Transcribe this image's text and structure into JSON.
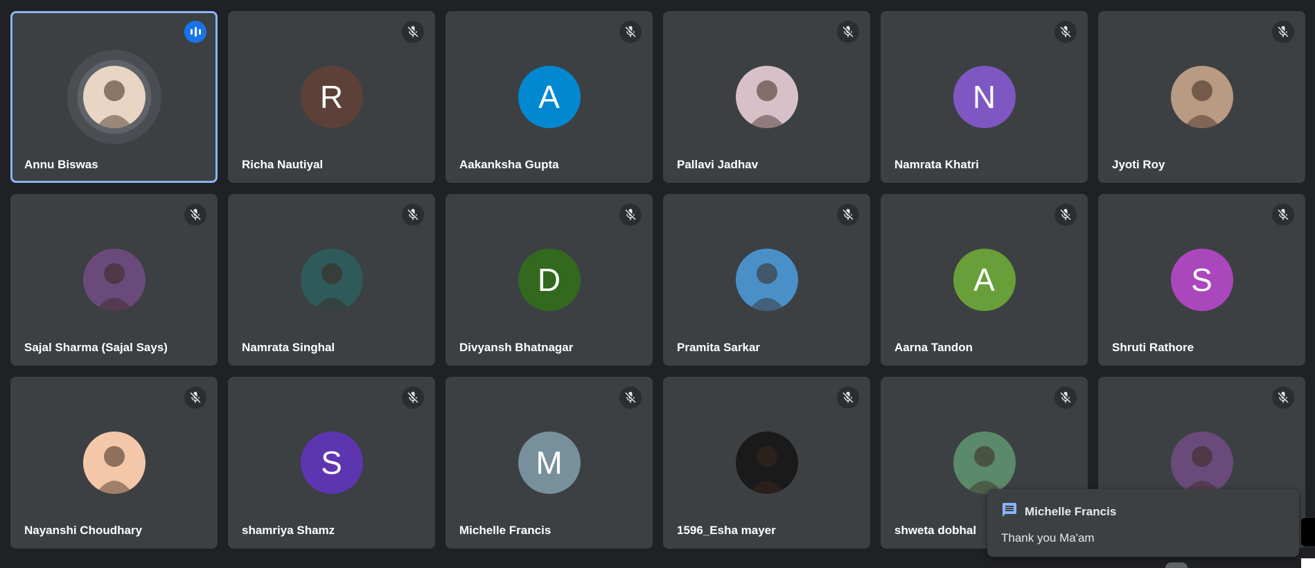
{
  "participants": [
    {
      "name": "Annu Biswas",
      "initial": "",
      "avatar_color": "#e8d5c4",
      "avatar": "photo",
      "speaking": true,
      "muted": false
    },
    {
      "name": "Richa Nautiyal",
      "initial": "R",
      "avatar_color": "#5d4037",
      "avatar": "letter",
      "speaking": false,
      "muted": true
    },
    {
      "name": "Aakanksha Gupta",
      "initial": "A",
      "avatar_color": "#0288d1",
      "avatar": "letter",
      "speaking": false,
      "muted": true
    },
    {
      "name": "Pallavi Jadhav",
      "initial": "",
      "avatar_color": "#d8c0c8",
      "avatar": "photo",
      "speaking": false,
      "muted": true
    },
    {
      "name": "Namrata Khatri",
      "initial": "N",
      "avatar_color": "#7e57c2",
      "avatar": "letter",
      "speaking": false,
      "muted": true
    },
    {
      "name": "Jyoti Roy",
      "initial": "",
      "avatar_color": "#b99a82",
      "avatar": "photo",
      "speaking": false,
      "muted": true
    },
    {
      "name": "Sajal Sharma (Sajal Says)",
      "initial": "",
      "avatar_color": "#6a4a7a",
      "avatar": "photo",
      "speaking": false,
      "muted": true
    },
    {
      "name": "Namrata Singhal",
      "initial": "",
      "avatar_color": "#2f5a5a",
      "avatar": "photo",
      "speaking": false,
      "muted": true
    },
    {
      "name": "Divyansh Bhatnagar",
      "initial": "D",
      "avatar_color": "#33691e",
      "avatar": "letter",
      "speaking": false,
      "muted": true
    },
    {
      "name": "Pramita Sarkar",
      "initial": "",
      "avatar_color": "#4a90c8",
      "avatar": "photo",
      "speaking": false,
      "muted": true
    },
    {
      "name": "Aarna Tandon",
      "initial": "A",
      "avatar_color": "#689f38",
      "avatar": "letter",
      "speaking": false,
      "muted": true
    },
    {
      "name": "Shruti Rathore",
      "initial": "S",
      "avatar_color": "#ab47bc",
      "avatar": "letter",
      "speaking": false,
      "muted": true
    },
    {
      "name": "Nayanshi Choudhary",
      "initial": "",
      "avatar_color": "#f4c7a8",
      "avatar": "photo",
      "speaking": false,
      "muted": true
    },
    {
      "name": "shamriya Shamz",
      "initial": "S",
      "avatar_color": "#5e35b1",
      "avatar": "letter",
      "speaking": false,
      "muted": true
    },
    {
      "name": "Michelle Francis",
      "initial": "M",
      "avatar_color": "#78909c",
      "avatar": "letter",
      "speaking": false,
      "muted": true
    },
    {
      "name": "1596_Esha mayer",
      "initial": "",
      "avatar_color": "#1a1a1a",
      "avatar": "photo",
      "speaking": false,
      "muted": true
    },
    {
      "name": "shweta dobhal",
      "initial": "",
      "avatar_color": "#5a8a6a",
      "avatar": "photo",
      "speaking": false,
      "muted": true
    },
    {
      "name": "",
      "initial": "",
      "avatar_color": "#6a4a7a",
      "avatar": "photo",
      "speaking": false,
      "muted": true
    }
  ],
  "toast": {
    "sender": "Michelle Francis",
    "message": "Thank you Ma'am",
    "icon": "chat-icon"
  },
  "colors": {
    "tile_bg": "#3c4043",
    "page_bg": "#202124",
    "speaking_outline": "#8ab4f8",
    "speaking_indicator": "#1a73e8"
  }
}
